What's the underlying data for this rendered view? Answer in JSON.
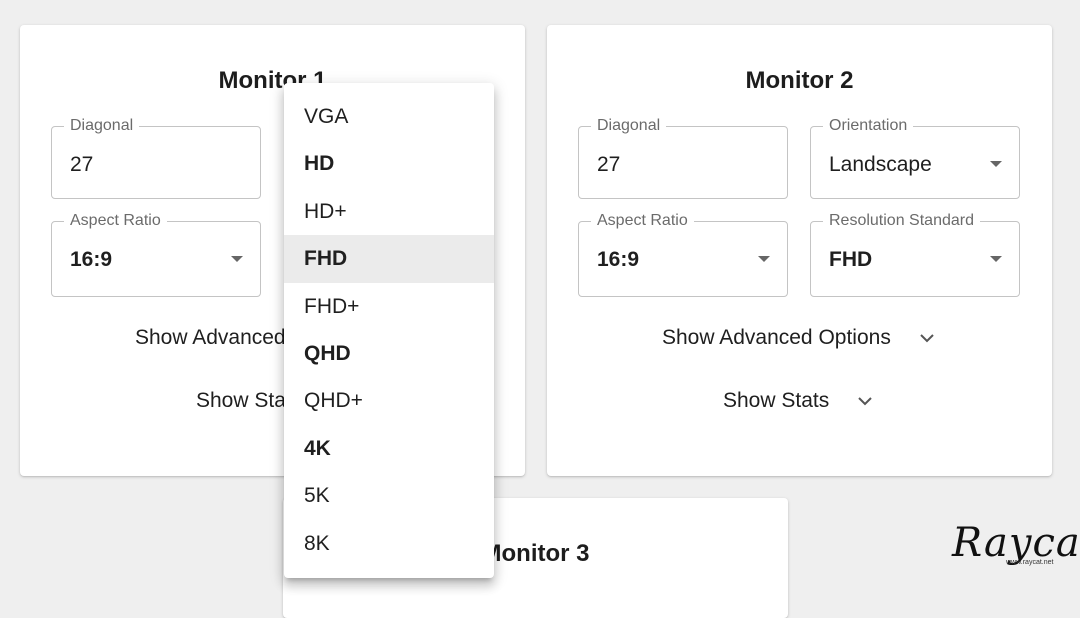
{
  "monitor1": {
    "title": "Monitor 1",
    "diagonal": {
      "label": "Diagonal",
      "value": "27"
    },
    "aspect_ratio": {
      "label": "Aspect Ratio",
      "value": "16:9"
    },
    "advanced_toggle": "Show Advanced",
    "stats_toggle": "Show Sta"
  },
  "monitor2": {
    "title": "Monitor 2",
    "diagonal": {
      "label": "Diagonal",
      "value": "27"
    },
    "orientation": {
      "label": "Orientation",
      "value": "Landscape"
    },
    "aspect_ratio": {
      "label": "Aspect Ratio",
      "value": "16:9"
    },
    "resolution_standard": {
      "label": "Resolution Standard",
      "value": "FHD"
    },
    "advanced_toggle": "Show Advanced Options",
    "stats_toggle": "Show Stats"
  },
  "monitor3": {
    "title": "Monitor 3"
  },
  "resolution_menu": {
    "selected": "FHD",
    "options": [
      {
        "label": "VGA",
        "bold": false
      },
      {
        "label": "HD",
        "bold": true
      },
      {
        "label": "HD+",
        "bold": false
      },
      {
        "label": "FHD",
        "bold": true
      },
      {
        "label": "FHD+",
        "bold": false
      },
      {
        "label": "QHD",
        "bold": true
      },
      {
        "label": "QHD+",
        "bold": false
      },
      {
        "label": "4K",
        "bold": true
      },
      {
        "label": "5K",
        "bold": false
      },
      {
        "label": "8K",
        "bold": false
      }
    ]
  },
  "watermark": {
    "brand": "Raycat",
    "url": "www.raycat.net"
  },
  "colors": {
    "background": "#efefef",
    "selected_item": "#ebebeb",
    "border": "#c4c4c4"
  }
}
